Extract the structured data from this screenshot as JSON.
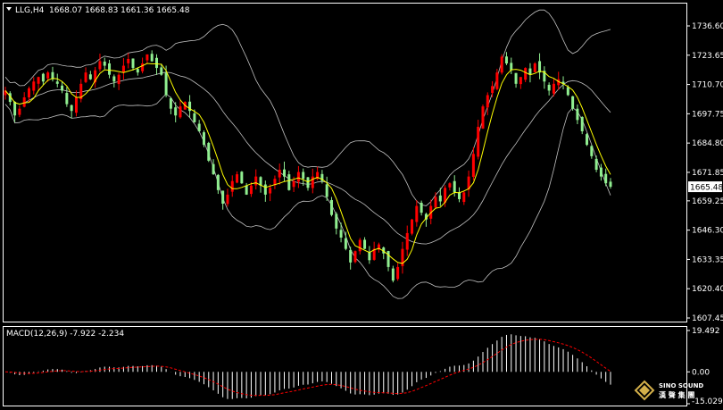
{
  "header": {
    "symbol": "LLG,H4",
    "ohlc": "1668.07 1668.83 1661.36 1665.48"
  },
  "macd": {
    "label": "MACD(12,26,9) -7.922 -2.234"
  },
  "brand": {
    "name": "SINO SOUND",
    "cn": "漢 聲 集 團"
  },
  "colors": {
    "background": "#000000",
    "bull": "#ff0000",
    "bear": "#90ee90",
    "ma": "#ffff00",
    "bands": "#c0c0c0",
    "hist": "#ffffff",
    "signal": "#ff0000",
    "grid": "#ffffff"
  },
  "chart_data": [
    {
      "type": "candlestick",
      "y_ticks": [
        1736.6,
        1723.65,
        1710.7,
        1697.75,
        1684.8,
        1671.85,
        1659.25,
        1646.3,
        1633.35,
        1620.4,
        1607.45
      ],
      "current_price": 1665.48,
      "ylim": [
        1607.45,
        1736.6
      ],
      "price_path": [
        1708,
        1703,
        1697,
        1700,
        1705,
        1709,
        1712,
        1714,
        1712,
        1716,
        1713,
        1711,
        1708,
        1702,
        1699,
        1705,
        1711,
        1716,
        1713,
        1717,
        1721,
        1719,
        1715,
        1712,
        1715,
        1719,
        1722,
        1718,
        1716,
        1720,
        1724,
        1721,
        1718,
        1715,
        1706,
        1700,
        1697,
        1701,
        1703,
        1699,
        1694,
        1690,
        1684,
        1677,
        1671,
        1664,
        1658,
        1662,
        1668,
        1671,
        1667,
        1662,
        1666,
        1670,
        1666,
        1662,
        1665,
        1669,
        1673,
        1670,
        1664,
        1668,
        1672,
        1669,
        1665,
        1670,
        1672,
        1668,
        1661,
        1653,
        1647,
        1643,
        1638,
        1632,
        1637,
        1642,
        1638,
        1633,
        1638,
        1640,
        1636,
        1630,
        1624,
        1630,
        1638,
        1645,
        1651,
        1657,
        1654,
        1651,
        1657,
        1661,
        1659,
        1665,
        1667,
        1663,
        1660,
        1663,
        1670,
        1680,
        1692,
        1701,
        1706,
        1710,
        1716,
        1723,
        1720,
        1717,
        1711,
        1714,
        1718,
        1715,
        1720,
        1716,
        1712,
        1708,
        1711,
        1713,
        1711,
        1706,
        1700,
        1695,
        1690,
        1684,
        1679,
        1673,
        1670,
        1667,
        1665.48
      ]
    },
    {
      "type": "bar",
      "y_ticks": [
        19.492,
        0.0,
        -15.029
      ],
      "ylim": [
        -15.029,
        19.492
      ],
      "macd_value": -7.922,
      "signal_value": -2.234
    }
  ]
}
